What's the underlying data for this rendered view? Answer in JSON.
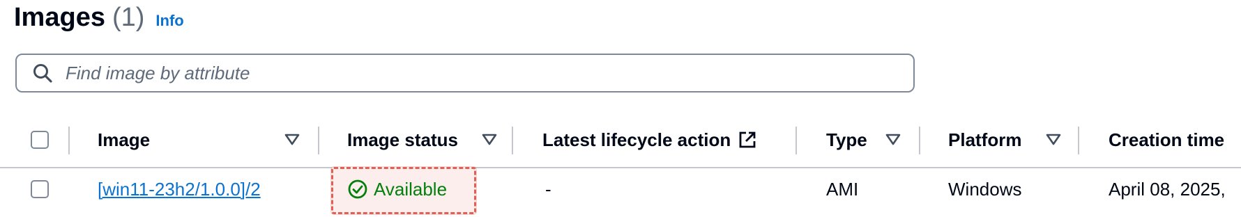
{
  "header": {
    "title": "Images",
    "count": "(1)",
    "info_link": "Info"
  },
  "search": {
    "placeholder": "Find image by attribute",
    "value": ""
  },
  "table": {
    "columns": {
      "image": "Image",
      "image_status": "Image status",
      "latest_lifecycle_action": "Latest lifecycle action",
      "type": "Type",
      "platform": "Platform",
      "creation_time": "Creation time"
    },
    "rows": [
      {
        "image": "[win11-23h2/1.0.0]/2",
        "image_status": "Available",
        "latest_lifecycle_action": "-",
        "type": "AMI",
        "platform": "Windows",
        "creation_time": "April 08, 2025,"
      }
    ]
  },
  "colors": {
    "link": "#0972d3",
    "status_available": "#037f0c",
    "highlight_dashed": "#e06055"
  },
  "icons": [
    "search-icon",
    "sort-caret-icon",
    "external-link-icon",
    "status-check-icon"
  ]
}
